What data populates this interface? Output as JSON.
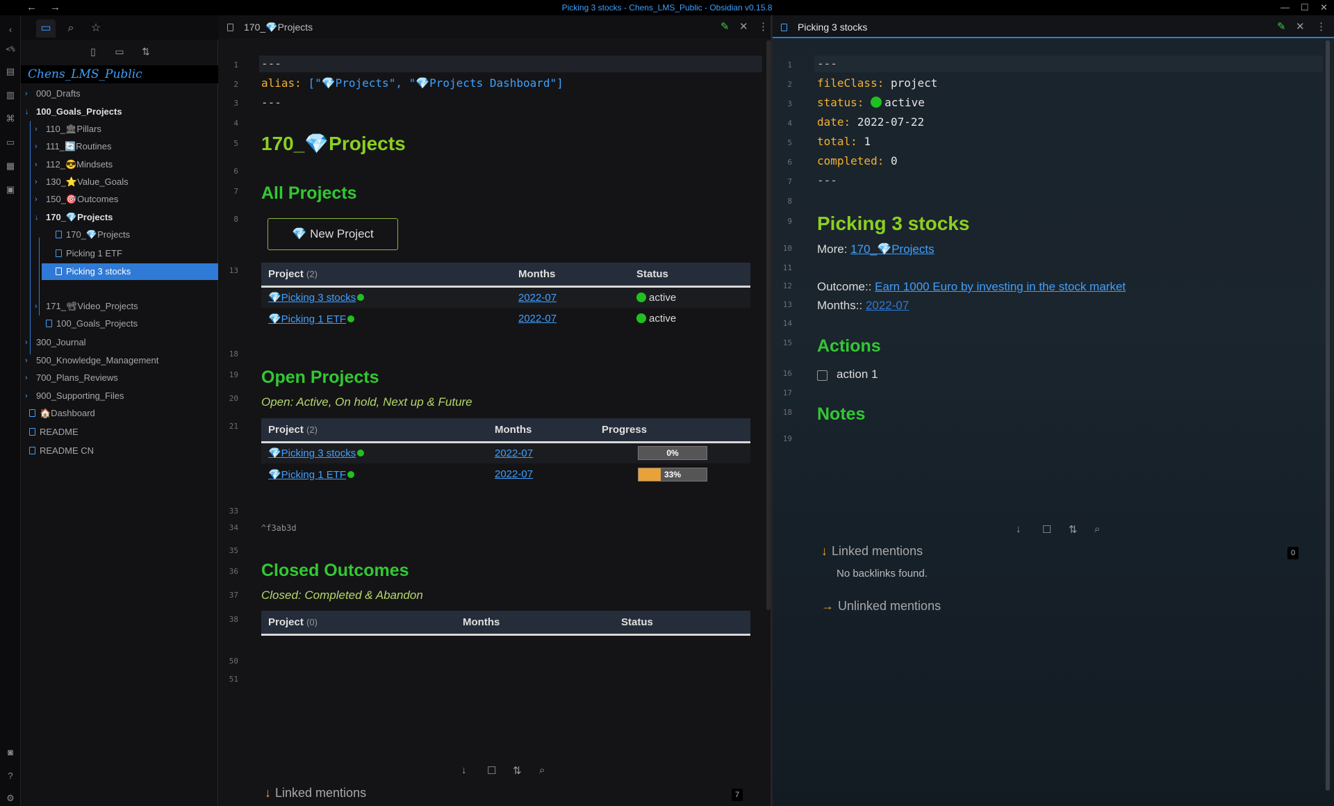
{
  "window": {
    "title": "Picking 3 stocks - Chens_LMS_Public - Obsidian v0.15.8"
  },
  "sidebar": {
    "vault_name": "Chens_LMS_Public",
    "items": [
      {
        "label": "000_Drafts"
      },
      {
        "label": "100_Goals_Projects"
      },
      {
        "label": "110_🏛Pillars"
      },
      {
        "label": "111_🔄Routines"
      },
      {
        "label": "112_😎Mindsets"
      },
      {
        "label": "130_⭐Value_Goals"
      },
      {
        "label": "150_🎯Outcomes"
      },
      {
        "label": "170_💎Projects"
      },
      {
        "label": "170_💎Projects"
      },
      {
        "label": "Picking 1 ETF"
      },
      {
        "label": "Picking 3 stocks"
      },
      {
        "label": "171_📽Video_Projects"
      },
      {
        "label": "100_Goals_Projects"
      },
      {
        "label": "300_Journal"
      },
      {
        "label": "500_Knowledge_Management"
      },
      {
        "label": "700_Plans_Reviews"
      },
      {
        "label": "900_Supporting_Files"
      },
      {
        "label": "🏠Dashboard"
      },
      {
        "label": "README"
      },
      {
        "label": "README CN"
      }
    ]
  },
  "left_pane": {
    "tab_title": "170_💎Projects",
    "line_numbers": [
      "1",
      "2",
      "3",
      "4",
      "5",
      "6",
      "7",
      "8",
      "13",
      "18",
      "19",
      "20",
      "21",
      "33",
      "34",
      "35",
      "36",
      "37",
      "38",
      "50",
      "51"
    ],
    "frontmatter": {
      "dash": "---",
      "alias_key": "alias:",
      "alias_val": "[\"💎Projects\", \"💎Projects Dashboard\"]"
    },
    "title": "170_💎Projects",
    "all_projects_heading": "All Projects",
    "new_project_button": "💎 New Project",
    "table1": {
      "headers": [
        "Project",
        "Months",
        "Status"
      ],
      "count": "(2)",
      "rows": [
        {
          "project": "💎Picking 3 stocks",
          "months": "2022-07",
          "status": "active"
        },
        {
          "project": "💎Picking 1 ETF",
          "months": "2022-07",
          "status": "active"
        }
      ]
    },
    "open_projects_heading": "Open Projects",
    "open_projects_sub": "Open: Active, On hold, Next up & Future",
    "table2": {
      "headers": [
        "Project",
        "Months",
        "Progress"
      ],
      "count": "(2)",
      "rows": [
        {
          "project": "💎Picking 3 stocks",
          "months": "2022-07",
          "progress": 0,
          "progress_label": "0%"
        },
        {
          "project": "💎Picking 1 ETF",
          "months": "2022-07",
          "progress": 33,
          "progress_label": "33%"
        }
      ]
    },
    "block_id": "^f3ab3d",
    "closed_heading": "Closed Outcomes",
    "closed_sub": "Closed: Completed & Abandon",
    "table3": {
      "headers": [
        "Project",
        "Months",
        "Status"
      ],
      "count": "(0)"
    },
    "linked_mentions": "Linked mentions",
    "linked_count": "7"
  },
  "right_pane": {
    "tab_title": "Picking 3 stocks",
    "line_numbers": [
      "1",
      "2",
      "3",
      "4",
      "5",
      "6",
      "7",
      "8",
      "9",
      "10",
      "11",
      "12",
      "13",
      "14",
      "15",
      "16",
      "17",
      "18",
      "19"
    ],
    "frontmatter": {
      "dash": "---",
      "fileclass_key": "fileClass:",
      "fileclass_val": "project",
      "status_key": "status:",
      "status_val": "active",
      "date_key": "date:",
      "date_val": "2022-07-22",
      "total_key": "total:",
      "total_val": "1",
      "completed_key": "completed:",
      "completed_val": "0"
    },
    "title": "Picking 3 stocks",
    "more_label": "More:",
    "more_link": "170_💎Projects",
    "outcome_label": "Outcome::",
    "outcome_link": "Earn 1000 Euro by investing in the stock market",
    "months_label": "Months::",
    "months_link": "2022-07",
    "actions_heading": "Actions",
    "action_item": "action 1",
    "notes_heading": "Notes",
    "linked_mentions": "Linked mentions",
    "linked_count": "0",
    "no_backlinks": "No backlinks found.",
    "unlinked_mentions": "Unlinked mentions"
  },
  "colors": {
    "accent": "#3fa0ff",
    "h1": "#8bd020",
    "h2": "#32c832",
    "status_active": "#20c020",
    "progress_fill": "#e8a23a"
  }
}
